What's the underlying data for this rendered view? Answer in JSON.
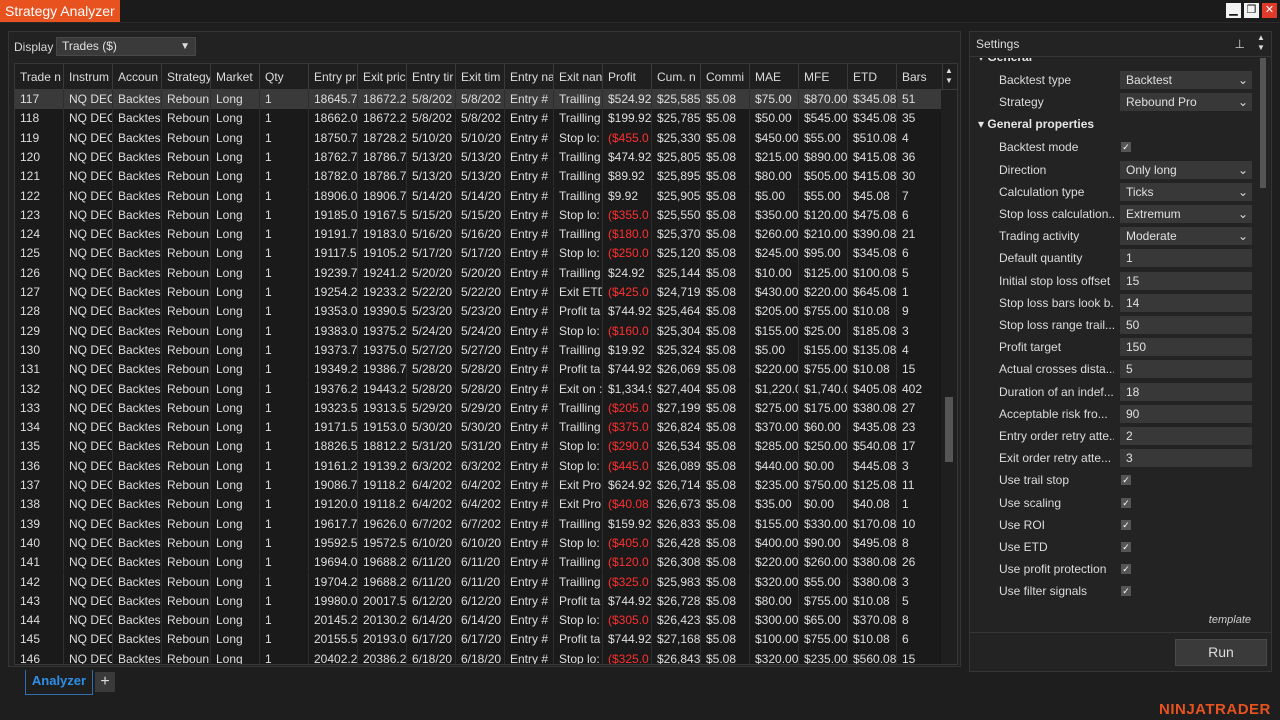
{
  "window": {
    "title": "Strategy Analyzer",
    "brand": "NINJATRADER"
  },
  "display": {
    "label": "Display",
    "value": "Trades ($)"
  },
  "columns": [
    "Trade n",
    "Instrum",
    "Accoun",
    "Strategy",
    "Market",
    "Qty",
    "Entry pr",
    "Exit pric",
    "Entry tir",
    "Exit tim",
    "Entry na",
    "Exit nan",
    "Profit",
    "Cum. n",
    "Commi",
    "MAE",
    "MFE",
    "ETD",
    "Bars"
  ],
  "rows": [
    [
      "117",
      "NQ DEC",
      "Backtes",
      "Reboun",
      "Long",
      "1",
      "18645.7",
      "18672.2",
      "5/8/202",
      "5/8/202",
      "Entry #",
      "Trailling",
      "$524.92",
      "$25,585",
      "$5.08",
      "$75.00",
      "$870.00",
      "$345.08",
      "51"
    ],
    [
      "118",
      "NQ DEC",
      "Backtes",
      "Reboun",
      "Long",
      "1",
      "18662.0",
      "18672.2",
      "5/8/202",
      "5/8/202",
      "Entry #",
      "Trailling",
      "$199.92",
      "$25,785",
      "$5.08",
      "$50.00",
      "$545.00",
      "$345.08",
      "35"
    ],
    [
      "119",
      "NQ DEC",
      "Backtes",
      "Reboun",
      "Long",
      "1",
      "18750.7",
      "18728.2",
      "5/10/20",
      "5/10/20",
      "Entry #",
      "Stop lo:",
      "($455.0",
      "$25,330",
      "$5.08",
      "$450.00",
      "$55.00",
      "$510.08",
      "4"
    ],
    [
      "120",
      "NQ DEC",
      "Backtes",
      "Reboun",
      "Long",
      "1",
      "18762.7",
      "18786.7",
      "5/13/20",
      "5/13/20",
      "Entry #",
      "Trailling",
      "$474.92",
      "$25,805",
      "$5.08",
      "$215.00",
      "$890.00",
      "$415.08",
      "36"
    ],
    [
      "121",
      "NQ DEC",
      "Backtes",
      "Reboun",
      "Long",
      "1",
      "18782.0",
      "18786.7",
      "5/13/20",
      "5/13/20",
      "Entry #",
      "Trailling",
      "$89.92",
      "$25,895",
      "$5.08",
      "$80.00",
      "$505.00",
      "$415.08",
      "30"
    ],
    [
      "122",
      "NQ DEC",
      "Backtes",
      "Reboun",
      "Long",
      "1",
      "18906.0",
      "18906.7",
      "5/14/20",
      "5/14/20",
      "Entry #",
      "Trailling",
      "$9.92",
      "$25,905",
      "$5.08",
      "$5.00",
      "$55.00",
      "$45.08",
      "7"
    ],
    [
      "123",
      "NQ DEC",
      "Backtes",
      "Reboun",
      "Long",
      "1",
      "19185.0",
      "19167.5",
      "5/15/20",
      "5/15/20",
      "Entry #",
      "Stop lo:",
      "($355.0",
      "$25,550",
      "$5.08",
      "$350.00",
      "$120.00",
      "$475.08",
      "6"
    ],
    [
      "124",
      "NQ DEC",
      "Backtes",
      "Reboun",
      "Long",
      "1",
      "19191.7",
      "19183.0",
      "5/16/20",
      "5/16/20",
      "Entry #",
      "Trailling",
      "($180.0",
      "$25,370",
      "$5.08",
      "$260.00",
      "$210.00",
      "$390.08",
      "21"
    ],
    [
      "125",
      "NQ DEC",
      "Backtes",
      "Reboun",
      "Long",
      "1",
      "19117.5",
      "19105.2",
      "5/17/20",
      "5/17/20",
      "Entry #",
      "Stop lo:",
      "($250.0",
      "$25,120",
      "$5.08",
      "$245.00",
      "$95.00",
      "$345.08",
      "6"
    ],
    [
      "126",
      "NQ DEC",
      "Backtes",
      "Reboun",
      "Long",
      "1",
      "19239.7",
      "19241.2",
      "5/20/20",
      "5/20/20",
      "Entry #",
      "Trailling",
      "$24.92",
      "$25,144",
      "$5.08",
      "$10.00",
      "$125.00",
      "$100.08",
      "5"
    ],
    [
      "127",
      "NQ DEC",
      "Backtes",
      "Reboun",
      "Long",
      "1",
      "19254.2",
      "19233.2",
      "5/22/20",
      "5/22/20",
      "Entry #",
      "Exit ETD",
      "($425.0",
      "$24,719",
      "$5.08",
      "$430.00",
      "$220.00",
      "$645.08",
      "1"
    ],
    [
      "128",
      "NQ DEC",
      "Backtes",
      "Reboun",
      "Long",
      "1",
      "19353.0",
      "19390.5",
      "5/23/20",
      "5/23/20",
      "Entry #",
      "Profit ta",
      "$744.92",
      "$25,464",
      "$5.08",
      "$205.00",
      "$755.00",
      "$10.08",
      "9"
    ],
    [
      "129",
      "NQ DEC",
      "Backtes",
      "Reboun",
      "Long",
      "1",
      "19383.0",
      "19375.2",
      "5/24/20",
      "5/24/20",
      "Entry #",
      "Stop lo:",
      "($160.0",
      "$25,304",
      "$5.08",
      "$155.00",
      "$25.00",
      "$185.08",
      "3"
    ],
    [
      "130",
      "NQ DEC",
      "Backtes",
      "Reboun",
      "Long",
      "1",
      "19373.7",
      "19375.0",
      "5/27/20",
      "5/27/20",
      "Entry #",
      "Trailling",
      "$19.92",
      "$25,324",
      "$5.08",
      "$5.00",
      "$155.00",
      "$135.08",
      "4"
    ],
    [
      "131",
      "NQ DEC",
      "Backtes",
      "Reboun",
      "Long",
      "1",
      "19349.2",
      "19386.7",
      "5/28/20",
      "5/28/20",
      "Entry #",
      "Profit ta",
      "$744.92",
      "$26,069",
      "$5.08",
      "$220.00",
      "$755.00",
      "$10.08",
      "15"
    ],
    [
      "132",
      "NQ DEC",
      "Backtes",
      "Reboun",
      "Long",
      "1",
      "19376.2",
      "19443.2",
      "5/28/20",
      "5/28/20",
      "Entry #",
      "Exit on :",
      "$1,334.9",
      "$27,404",
      "$5.08",
      "$1,220.0",
      "$1,740.0",
      "$405.08",
      "402"
    ],
    [
      "133",
      "NQ DEC",
      "Backtes",
      "Reboun",
      "Long",
      "1",
      "19323.5",
      "19313.5",
      "5/29/20",
      "5/29/20",
      "Entry #",
      "Trailling",
      "($205.0",
      "$27,199",
      "$5.08",
      "$275.00",
      "$175.00",
      "$380.08",
      "27"
    ],
    [
      "134",
      "NQ DEC",
      "Backtes",
      "Reboun",
      "Long",
      "1",
      "19171.5",
      "19153.0",
      "5/30/20",
      "5/30/20",
      "Entry #",
      "Trailling",
      "($375.0",
      "$26,824",
      "$5.08",
      "$370.00",
      "$60.00",
      "$435.08",
      "23"
    ],
    [
      "135",
      "NQ DEC",
      "Backtes",
      "Reboun",
      "Long",
      "1",
      "18826.5",
      "18812.2",
      "5/31/20",
      "5/31/20",
      "Entry #",
      "Stop lo:",
      "($290.0",
      "$26,534",
      "$5.08",
      "$285.00",
      "$250.00",
      "$540.08",
      "17"
    ],
    [
      "136",
      "NQ DEC",
      "Backtes",
      "Reboun",
      "Long",
      "1",
      "19161.2",
      "19139.2",
      "6/3/202",
      "6/3/202",
      "Entry #",
      "Stop lo:",
      "($445.0",
      "$26,089",
      "$5.08",
      "$440.00",
      "$0.00",
      "$445.08",
      "3"
    ],
    [
      "137",
      "NQ DEC",
      "Backtes",
      "Reboun",
      "Long",
      "1",
      "19086.7",
      "19118.2",
      "6/4/202",
      "6/4/202",
      "Entry #",
      "Exit Pro",
      "$624.92",
      "$26,714",
      "$5.08",
      "$235.00",
      "$750.00",
      "$125.08",
      "11"
    ],
    [
      "138",
      "NQ DEC",
      "Backtes",
      "Reboun",
      "Long",
      "1",
      "19120.0",
      "19118.2",
      "6/4/202",
      "6/4/202",
      "Entry #",
      "Exit Pro",
      "($40.08",
      "$26,673",
      "$5.08",
      "$35.00",
      "$0.00",
      "$40.08",
      "1"
    ],
    [
      "139",
      "NQ DEC",
      "Backtes",
      "Reboun",
      "Long",
      "1",
      "19617.7",
      "19626.0",
      "6/7/202",
      "6/7/202",
      "Entry #",
      "Trailling",
      "$159.92",
      "$26,833",
      "$5.08",
      "$155.00",
      "$330.00",
      "$170.08",
      "10"
    ],
    [
      "140",
      "NQ DEC",
      "Backtes",
      "Reboun",
      "Long",
      "1",
      "19592.5",
      "19572.5",
      "6/10/20",
      "6/10/20",
      "Entry #",
      "Stop lo:",
      "($405.0",
      "$26,428",
      "$5.08",
      "$400.00",
      "$90.00",
      "$495.08",
      "8"
    ],
    [
      "141",
      "NQ DEC",
      "Backtes",
      "Reboun",
      "Long",
      "1",
      "19694.0",
      "19688.2",
      "6/11/20",
      "6/11/20",
      "Entry #",
      "Trailling",
      "($120.0",
      "$26,308",
      "$5.08",
      "$220.00",
      "$260.00",
      "$380.08",
      "26"
    ],
    [
      "142",
      "NQ DEC",
      "Backtes",
      "Reboun",
      "Long",
      "1",
      "19704.2",
      "19688.2",
      "6/11/20",
      "6/11/20",
      "Entry #",
      "Trailling",
      "($325.0",
      "$25,983",
      "$5.08",
      "$320.00",
      "$55.00",
      "$380.08",
      "3"
    ],
    [
      "143",
      "NQ DEC",
      "Backtes",
      "Reboun",
      "Long",
      "1",
      "19980.0",
      "20017.5",
      "6/12/20",
      "6/12/20",
      "Entry #",
      "Profit ta",
      "$744.92",
      "$26,728",
      "$5.08",
      "$80.00",
      "$755.00",
      "$10.08",
      "5"
    ],
    [
      "144",
      "NQ DEC",
      "Backtes",
      "Reboun",
      "Long",
      "1",
      "20145.2",
      "20130.2",
      "6/14/20",
      "6/14/20",
      "Entry #",
      "Stop lo:",
      "($305.0",
      "$26,423",
      "$5.08",
      "$300.00",
      "$65.00",
      "$370.08",
      "8"
    ],
    [
      "145",
      "NQ DEC",
      "Backtes",
      "Reboun",
      "Long",
      "1",
      "20155.5",
      "20193.0",
      "6/17/20",
      "6/17/20",
      "Entry #",
      "Profit ta",
      "$744.92",
      "$27,168",
      "$5.08",
      "$100.00",
      "$755.00",
      "$10.08",
      "6"
    ],
    [
      "146",
      "NQ DEC",
      "Backtes",
      "Reboun",
      "Long",
      "1",
      "20402.2",
      "20386.2",
      "6/18/20",
      "6/18/20",
      "Entry #",
      "Stop lo:",
      "($325.0",
      "$26,843",
      "$5.08",
      "$320.00",
      "$235.00",
      "$560.08",
      "15"
    ]
  ],
  "tabs": {
    "active": "Analyzer",
    "add": "+"
  },
  "settings": {
    "title": "Settings",
    "section_general": "General",
    "section_general_props": "General properties",
    "properties": [
      {
        "label": "Backtest type",
        "value": "Backtest",
        "kind": "select"
      },
      {
        "label": "Strategy",
        "value": "Rebound Pro",
        "kind": "select"
      },
      {
        "label": "Backtest mode",
        "value": "✓",
        "kind": "check"
      },
      {
        "label": "Direction",
        "value": "Only long",
        "kind": "select"
      },
      {
        "label": "Calculation type",
        "value": "Ticks",
        "kind": "select"
      },
      {
        "label": "Stop loss calculation...",
        "value": "Extremum",
        "kind": "select"
      },
      {
        "label": "Trading activity",
        "value": "Moderate",
        "kind": "select"
      },
      {
        "label": "Default quantity",
        "value": "1",
        "kind": "text"
      },
      {
        "label": "Initial stop loss offset",
        "value": "15",
        "kind": "text"
      },
      {
        "label": "Stop loss bars look b...",
        "value": "14",
        "kind": "text"
      },
      {
        "label": "Stop loss range trail...",
        "value": "50",
        "kind": "text"
      },
      {
        "label": "Profit target",
        "value": "150",
        "kind": "text"
      },
      {
        "label": "Actual crosses dista...",
        "value": "5",
        "kind": "text"
      },
      {
        "label": "Duration of an indef...",
        "value": "18",
        "kind": "text"
      },
      {
        "label": "Acceptable risk fro...",
        "value": "90",
        "kind": "text"
      },
      {
        "label": "Entry order retry atte...",
        "value": "2",
        "kind": "text"
      },
      {
        "label": "Exit order retry atte...",
        "value": "3",
        "kind": "text"
      },
      {
        "label": "Use trail stop",
        "value": "✓",
        "kind": "check"
      },
      {
        "label": "Use scaling",
        "value": "✓",
        "kind": "check"
      },
      {
        "label": "Use ROI",
        "value": "✓",
        "kind": "check"
      },
      {
        "label": "Use ETD",
        "value": "✓",
        "kind": "check"
      },
      {
        "label": "Use profit protection",
        "value": "✓",
        "kind": "check"
      },
      {
        "label": "Use filter signals",
        "value": "✓",
        "kind": "check"
      }
    ],
    "template_label": "template",
    "run_label": "Run"
  },
  "colors": {
    "accent": "#e8521f",
    "negative": "#ff3030",
    "tab": "#2e8fe8"
  }
}
